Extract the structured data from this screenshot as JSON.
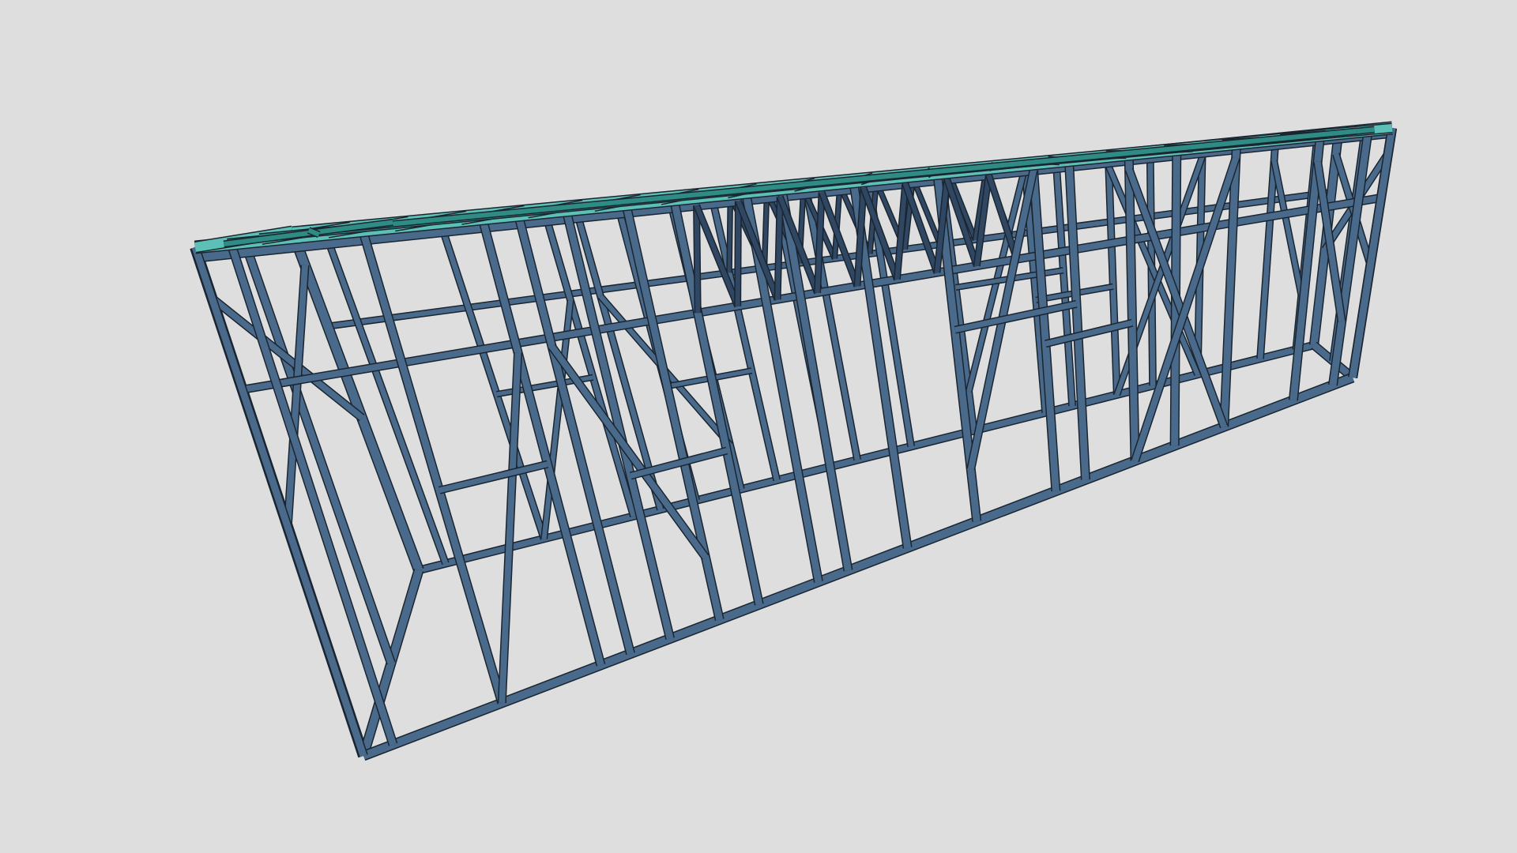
{
  "viewport": {
    "background": "#dedede",
    "object": "steel-frame-structure"
  },
  "colors": {
    "wall_frame": "#4a6a8c",
    "wall_frame_dark": "#2f4763",
    "roof_frame": "#5cc0b6",
    "roof_frame_dark": "#2f8c84",
    "outline": "#1a2530"
  }
}
